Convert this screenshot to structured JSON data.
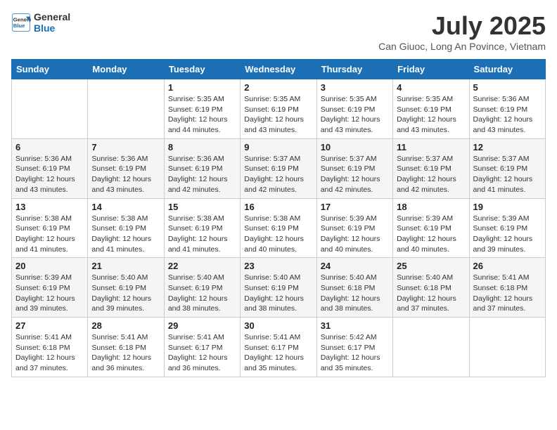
{
  "header": {
    "logo_line1": "General",
    "logo_line2": "Blue",
    "month_year": "July 2025",
    "location": "Can Giuoc, Long An Povince, Vietnam"
  },
  "weekdays": [
    "Sunday",
    "Monday",
    "Tuesday",
    "Wednesday",
    "Thursday",
    "Friday",
    "Saturday"
  ],
  "weeks": [
    [
      {
        "day": "",
        "info": ""
      },
      {
        "day": "",
        "info": ""
      },
      {
        "day": "1",
        "info": "Sunrise: 5:35 AM\nSunset: 6:19 PM\nDaylight: 12 hours and 44 minutes."
      },
      {
        "day": "2",
        "info": "Sunrise: 5:35 AM\nSunset: 6:19 PM\nDaylight: 12 hours and 43 minutes."
      },
      {
        "day": "3",
        "info": "Sunrise: 5:35 AM\nSunset: 6:19 PM\nDaylight: 12 hours and 43 minutes."
      },
      {
        "day": "4",
        "info": "Sunrise: 5:35 AM\nSunset: 6:19 PM\nDaylight: 12 hours and 43 minutes."
      },
      {
        "day": "5",
        "info": "Sunrise: 5:36 AM\nSunset: 6:19 PM\nDaylight: 12 hours and 43 minutes."
      }
    ],
    [
      {
        "day": "6",
        "info": "Sunrise: 5:36 AM\nSunset: 6:19 PM\nDaylight: 12 hours and 43 minutes."
      },
      {
        "day": "7",
        "info": "Sunrise: 5:36 AM\nSunset: 6:19 PM\nDaylight: 12 hours and 43 minutes."
      },
      {
        "day": "8",
        "info": "Sunrise: 5:36 AM\nSunset: 6:19 PM\nDaylight: 12 hours and 42 minutes."
      },
      {
        "day": "9",
        "info": "Sunrise: 5:37 AM\nSunset: 6:19 PM\nDaylight: 12 hours and 42 minutes."
      },
      {
        "day": "10",
        "info": "Sunrise: 5:37 AM\nSunset: 6:19 PM\nDaylight: 12 hours and 42 minutes."
      },
      {
        "day": "11",
        "info": "Sunrise: 5:37 AM\nSunset: 6:19 PM\nDaylight: 12 hours and 42 minutes."
      },
      {
        "day": "12",
        "info": "Sunrise: 5:37 AM\nSunset: 6:19 PM\nDaylight: 12 hours and 41 minutes."
      }
    ],
    [
      {
        "day": "13",
        "info": "Sunrise: 5:38 AM\nSunset: 6:19 PM\nDaylight: 12 hours and 41 minutes."
      },
      {
        "day": "14",
        "info": "Sunrise: 5:38 AM\nSunset: 6:19 PM\nDaylight: 12 hours and 41 minutes."
      },
      {
        "day": "15",
        "info": "Sunrise: 5:38 AM\nSunset: 6:19 PM\nDaylight: 12 hours and 41 minutes."
      },
      {
        "day": "16",
        "info": "Sunrise: 5:38 AM\nSunset: 6:19 PM\nDaylight: 12 hours and 40 minutes."
      },
      {
        "day": "17",
        "info": "Sunrise: 5:39 AM\nSunset: 6:19 PM\nDaylight: 12 hours and 40 minutes."
      },
      {
        "day": "18",
        "info": "Sunrise: 5:39 AM\nSunset: 6:19 PM\nDaylight: 12 hours and 40 minutes."
      },
      {
        "day": "19",
        "info": "Sunrise: 5:39 AM\nSunset: 6:19 PM\nDaylight: 12 hours and 39 minutes."
      }
    ],
    [
      {
        "day": "20",
        "info": "Sunrise: 5:39 AM\nSunset: 6:19 PM\nDaylight: 12 hours and 39 minutes."
      },
      {
        "day": "21",
        "info": "Sunrise: 5:40 AM\nSunset: 6:19 PM\nDaylight: 12 hours and 39 minutes."
      },
      {
        "day": "22",
        "info": "Sunrise: 5:40 AM\nSunset: 6:19 PM\nDaylight: 12 hours and 38 minutes."
      },
      {
        "day": "23",
        "info": "Sunrise: 5:40 AM\nSunset: 6:19 PM\nDaylight: 12 hours and 38 minutes."
      },
      {
        "day": "24",
        "info": "Sunrise: 5:40 AM\nSunset: 6:18 PM\nDaylight: 12 hours and 38 minutes."
      },
      {
        "day": "25",
        "info": "Sunrise: 5:40 AM\nSunset: 6:18 PM\nDaylight: 12 hours and 37 minutes."
      },
      {
        "day": "26",
        "info": "Sunrise: 5:41 AM\nSunset: 6:18 PM\nDaylight: 12 hours and 37 minutes."
      }
    ],
    [
      {
        "day": "27",
        "info": "Sunrise: 5:41 AM\nSunset: 6:18 PM\nDaylight: 12 hours and 37 minutes."
      },
      {
        "day": "28",
        "info": "Sunrise: 5:41 AM\nSunset: 6:18 PM\nDaylight: 12 hours and 36 minutes."
      },
      {
        "day": "29",
        "info": "Sunrise: 5:41 AM\nSunset: 6:17 PM\nDaylight: 12 hours and 36 minutes."
      },
      {
        "day": "30",
        "info": "Sunrise: 5:41 AM\nSunset: 6:17 PM\nDaylight: 12 hours and 35 minutes."
      },
      {
        "day": "31",
        "info": "Sunrise: 5:42 AM\nSunset: 6:17 PM\nDaylight: 12 hours and 35 minutes."
      },
      {
        "day": "",
        "info": ""
      },
      {
        "day": "",
        "info": ""
      }
    ]
  ]
}
